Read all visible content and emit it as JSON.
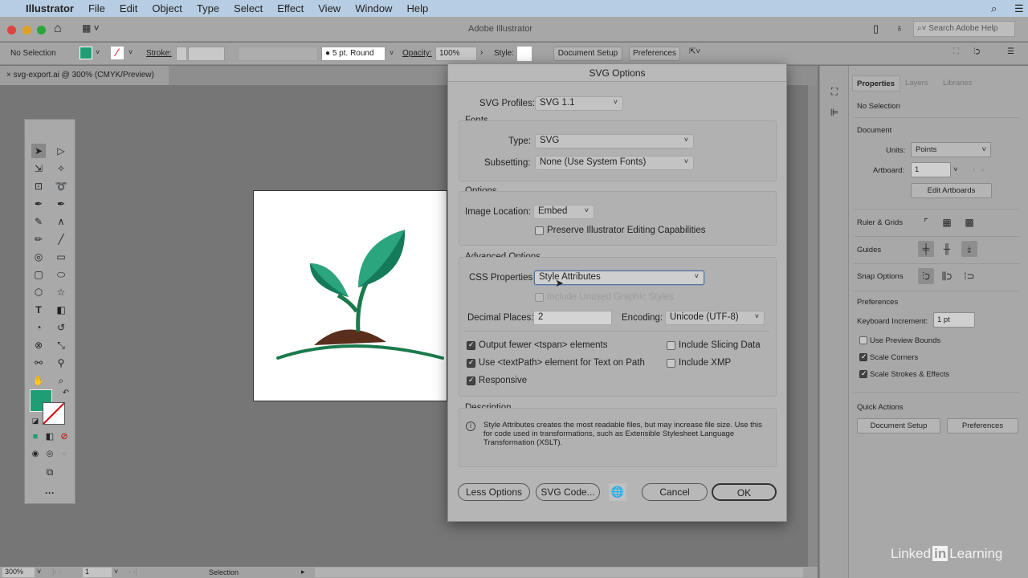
{
  "menubar": {
    "app": "Illustrator",
    "items": [
      "File",
      "Edit",
      "Object",
      "Type",
      "Select",
      "Effect",
      "View",
      "Window",
      "Help"
    ]
  },
  "titlebar": {
    "title": "Adobe Illustrator",
    "search_placeholder": "Search Adobe Help"
  },
  "control": {
    "selection": "No Selection",
    "stroke_label": "Stroke:",
    "brush": "5 pt. Round",
    "opacity_label": "Opacity:",
    "opacity": "100%",
    "style_label": "Style:",
    "document_setup": "Document Setup",
    "preferences": "Preferences",
    "fill_color": "#1f9e76"
  },
  "document_tab": {
    "title": "svg-export.ai @ 300% (CMYK/Preview)"
  },
  "artwork": {
    "leaf_light": "#2aa57d",
    "leaf_dark": "#157a5a",
    "soil": "#5a2e1c",
    "ground": "#1b7a4c"
  },
  "dialog": {
    "title": "SVG Options",
    "svg_profiles_label": "SVG Profiles:",
    "svg_profiles": "SVG 1.1",
    "fonts_label": "Fonts",
    "type_label": "Type:",
    "type": "SVG",
    "subsetting_label": "Subsetting:",
    "subsetting": "None (Use System Fonts)",
    "options_label": "Options",
    "image_location_label": "Image Location:",
    "image_location": "Embed",
    "preserve_label": "Preserve Illustrator Editing Capabilities",
    "advanced_label": "Advanced Options",
    "css_label": "CSS Properties:",
    "css": "Style Attributes",
    "unused_styles_label": "Include Unused Graphic Styles",
    "decimal_label": "Decimal Places:",
    "decimal": "2",
    "encoding_label": "Encoding:",
    "encoding": "Unicode (UTF-8)",
    "checks": [
      {
        "label": "Output fewer <tspan> elements",
        "checked": true
      },
      {
        "label": "Use <textPath> element for Text on Path",
        "checked": true
      },
      {
        "label": "Responsive",
        "checked": true
      },
      {
        "label": "Include Slicing Data",
        "checked": false
      },
      {
        "label": "Include XMP",
        "checked": false
      }
    ],
    "description_label": "Description",
    "description": "Style Attributes creates the most readable files, but may increase file size. Use this for code used in transformations, such as Extensible Stylesheet Language Transformation (XSLT).",
    "less_options": "Less Options",
    "svg_code": "SVG Code...",
    "cancel": "Cancel",
    "ok": "OK"
  },
  "properties": {
    "tabs": [
      "Properties",
      "Layers",
      "Libraries"
    ],
    "no_selection": "No Selection",
    "document": "Document",
    "units_label": "Units:",
    "units": "Points",
    "artboard_label": "Artboard:",
    "artboard": "1",
    "edit_artboards": "Edit Artboards",
    "ruler_grids": "Ruler & Grids",
    "guides": "Guides",
    "snap_options": "Snap Options",
    "preferences": "Preferences",
    "keyboard_increment_label": "Keyboard Increment:",
    "keyboard_increment": "1 pt",
    "use_preview_bounds": "Use Preview Bounds",
    "scale_corners": "Scale Corners",
    "scale_strokes": "Scale Strokes & Effects",
    "quick_actions": "Quick Actions",
    "document_setup": "Document Setup",
    "preferences_btn": "Preferences"
  },
  "status": {
    "zoom": "300%",
    "artboard": "1",
    "tool": "Selection"
  },
  "watermark": {
    "linkedin": "Linked",
    "in": "in",
    "learning": "Learning"
  }
}
